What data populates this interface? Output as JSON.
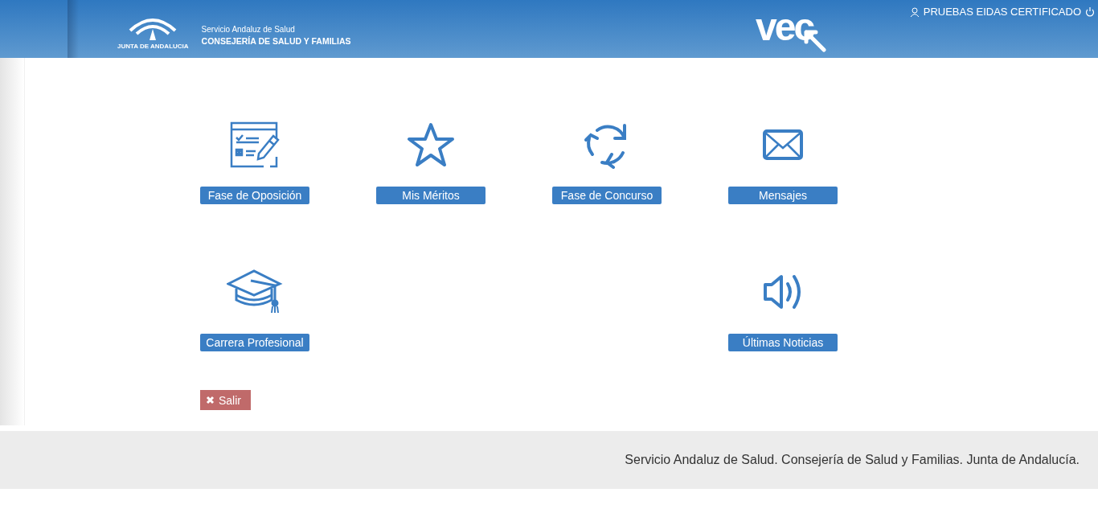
{
  "header": {
    "emblem_caption": "JUNTA DE ANDALUCIA",
    "org_line": "Servicio Andaluz de Salud",
    "dept_line": "CONSEJERÍA DE SALUD Y FAMILIAS",
    "app_logo": "vec",
    "user_name": "PRUEBAS EIDAS CERTIFICADO"
  },
  "tiles": [
    {
      "kind": "tile",
      "label": "Fase de Oposición"
    },
    {
      "kind": "tile",
      "label": "Mis Méritos"
    },
    {
      "kind": "tile",
      "label": "Fase de Concurso"
    },
    {
      "kind": "tile",
      "label": "Mensajes"
    },
    {
      "kind": "tile",
      "label": "Carrera Profesional"
    },
    {
      "kind": "empty"
    },
    {
      "kind": "empty"
    },
    {
      "kind": "tile",
      "label": "Últimas Noticias"
    }
  ],
  "exit_button": "Salir",
  "footer": "Servicio Andaluz de Salud. Consejería de Salud y Familias. Junta de Andalucía."
}
